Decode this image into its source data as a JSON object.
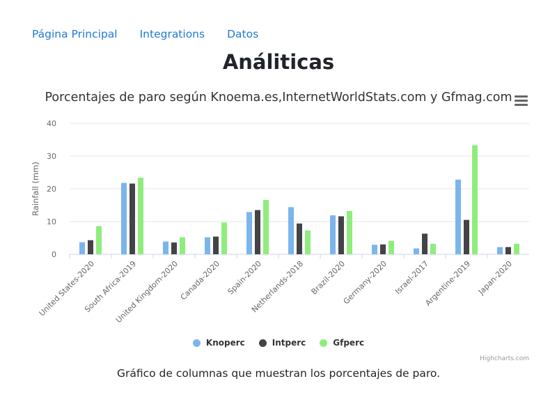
{
  "nav": {
    "items": [
      {
        "label": "Página Principal"
      },
      {
        "label": "Integrations"
      },
      {
        "label": "Datos"
      }
    ]
  },
  "page": {
    "title": "Análiticas",
    "caption": "Gráfico de columnas que muestran los porcentajes de paro."
  },
  "credits": "Highcharts.com",
  "chart_data": {
    "type": "bar",
    "title": "Porcentajes de paro según Knoema.es,InternetWorldStats.com y Gfmag.com",
    "xlabel": "",
    "ylabel": "Rainfall (mm)",
    "ylim": [
      0,
      40
    ],
    "yticks": [
      "0",
      "10",
      "20",
      "30",
      "40"
    ],
    "grid": true,
    "legend_position": "bottom-center",
    "categories": [
      "United States-2020",
      "South Africa-2019",
      "United Kingdom-2020",
      "Canada-2020",
      "Spain-2020",
      "Netherlands-2018",
      "Brazil-2020",
      "Germany-2020",
      "Israel-2017",
      "Argentine-2019",
      "Japan-2020"
    ],
    "series": [
      {
        "name": "Knoperc",
        "color": "#7cb5ec",
        "values": [
          3.7,
          21.8,
          3.9,
          5.2,
          12.9,
          14.4,
          11.9,
          2.9,
          1.8,
          22.8,
          2.2
        ]
      },
      {
        "name": "Intperc",
        "color": "#434348",
        "values": [
          4.3,
          21.6,
          3.6,
          5.4,
          13.5,
          9.4,
          11.6,
          3.0,
          6.3,
          10.5,
          2.2
        ]
      },
      {
        "name": "Gfperc",
        "color": "#90ed7d",
        "values": [
          8.6,
          23.4,
          5.2,
          9.7,
          16.6,
          7.3,
          13.2,
          4.1,
          3.2,
          33.3,
          3.2
        ]
      }
    ]
  },
  "menu": {
    "icon": "hamburger-menu-icon"
  }
}
